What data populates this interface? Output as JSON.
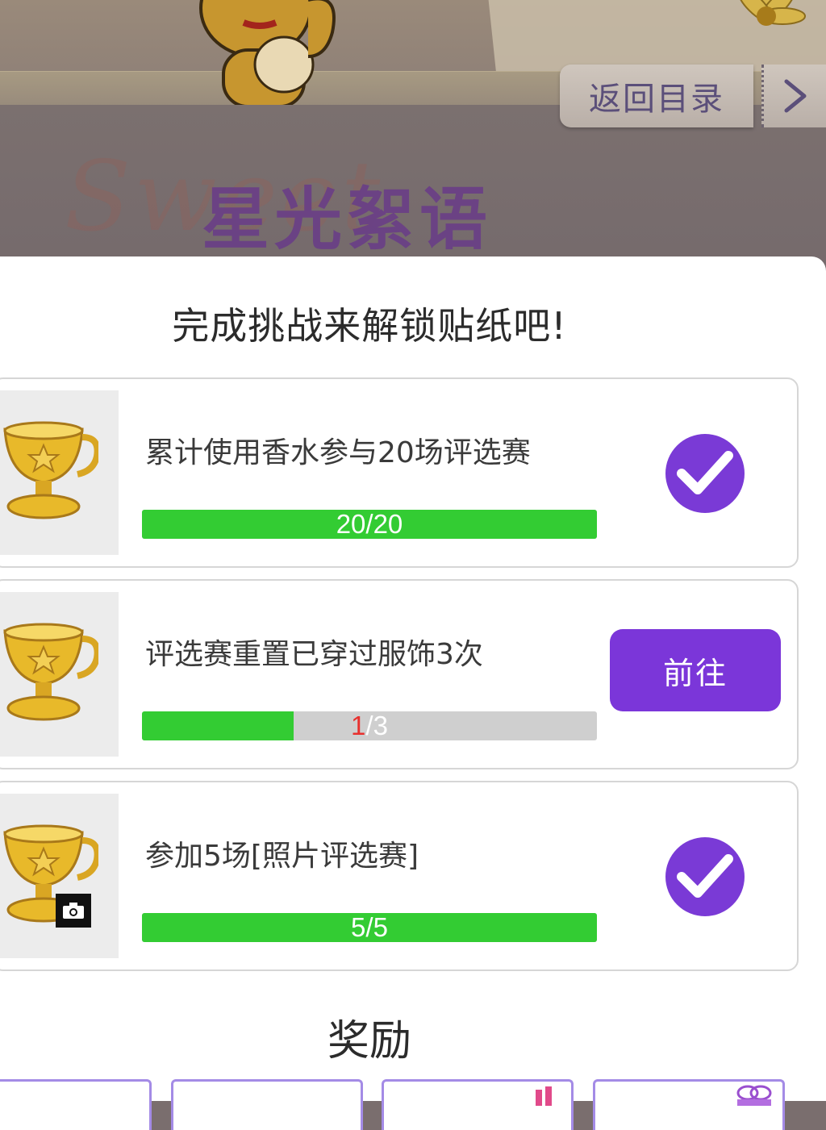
{
  "header": {
    "back_label": "返回目录",
    "banner_title": "星光絮语",
    "banner_script": "Sweet Whisper"
  },
  "panel": {
    "title": "完成挑战来解锁贴纸吧!",
    "tasks": [
      {
        "text": "累计使用香水参与20场评选赛",
        "progress_current": "20",
        "progress_sep": "/",
        "progress_total": "20",
        "progress_fraction": 1.0,
        "status": "completed",
        "icon": "trophy-icon"
      },
      {
        "text": "评选赛重置已穿过服饰3次",
        "progress_current": "1",
        "progress_sep": "/",
        "progress_total": "3",
        "progress_fraction": 0.3333,
        "status": "in-progress",
        "action_label": "前往",
        "icon": "trophy-icon"
      },
      {
        "text": "参加5场[照片评选赛]",
        "progress_current": "5",
        "progress_sep": "/",
        "progress_total": "5",
        "progress_fraction": 1.0,
        "status": "completed",
        "icon": "trophy-camera-icon"
      }
    ],
    "reward_title": "奖励"
  },
  "colors": {
    "accent_purple": "#7b36d9",
    "progress_green": "#33cc33",
    "progress_track": "#cfcfcf",
    "current_red": "#e8302e"
  }
}
